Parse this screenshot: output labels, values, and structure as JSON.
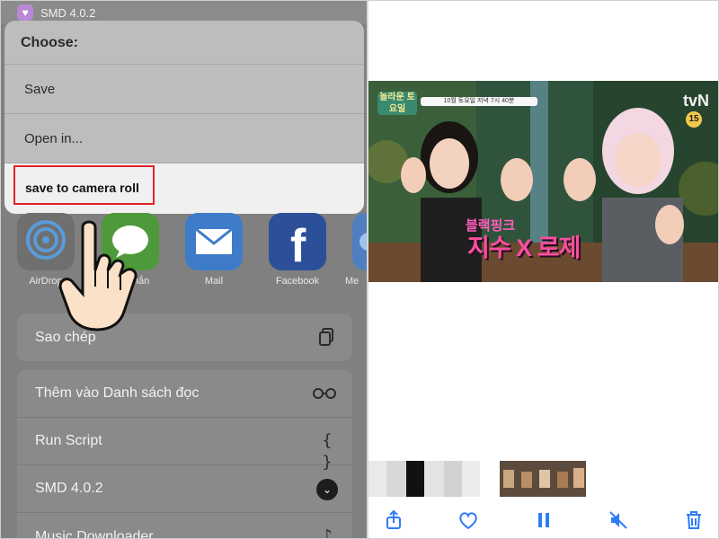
{
  "app": {
    "title": "SMD 4.0.2"
  },
  "sheet": {
    "heading": "Choose:",
    "items": [
      {
        "label": "Save"
      },
      {
        "label": "Open in..."
      },
      {
        "label": "save to camera roll"
      }
    ]
  },
  "share_targets": [
    {
      "label": "AirDrop",
      "icon": "airdrop-icon"
    },
    {
      "label": "Tin nhắn",
      "icon": "messages-icon"
    },
    {
      "label": "Mail",
      "icon": "mail-icon"
    },
    {
      "label": "Facebook",
      "icon": "facebook-icon"
    },
    {
      "label": "Me",
      "icon": "more-app-icon"
    }
  ],
  "actions_primary": [
    {
      "label": "Sao chép",
      "icon": "copy-icon"
    }
  ],
  "actions_secondary": [
    {
      "label": "Thêm vào Danh sách đọc",
      "icon": "glasses-icon"
    },
    {
      "label": "Run Script",
      "icon": "braces-icon"
    },
    {
      "label": "SMD 4.0.2",
      "icon": "chevron-down-icon"
    },
    {
      "label": "Music Downloader",
      "icon": "music-note-icon"
    }
  ],
  "video": {
    "channel": "tvN",
    "age_rating": "15",
    "badge_text": "놀라운\n토요일",
    "schedule_text": "10월 토요일 저녁 7시 40분",
    "caption_top": "블랙핑크",
    "caption_main": "지수 X 로제"
  },
  "toolbar": {
    "share_icon": "share-icon",
    "like_icon": "heart-icon",
    "pause_icon": "pause-icon",
    "mute_icon": "mute-icon",
    "delete_icon": "trash-icon"
  },
  "colors": {
    "highlight_border": "#e0232a",
    "ios_blue": "#2f7cf6",
    "caption_pink": "#f74f9e"
  }
}
